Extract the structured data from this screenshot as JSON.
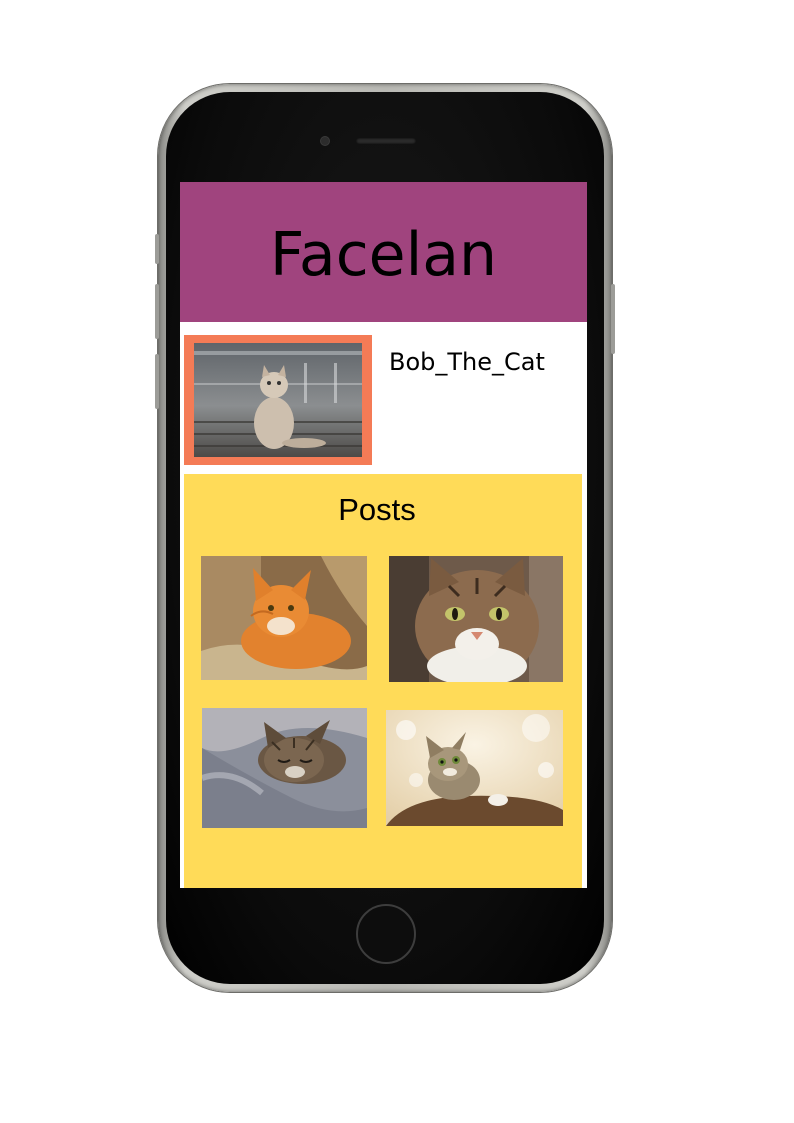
{
  "app": {
    "title": "Facelan"
  },
  "profile": {
    "username": "Bob_The_Cat",
    "avatar_icon": "cat-photo"
  },
  "posts": {
    "title": "Posts",
    "items": [
      {
        "icon": "orange-cat-photo"
      },
      {
        "icon": "tabby-cat-face-photo"
      },
      {
        "icon": "sleeping-cat-photo"
      },
      {
        "icon": "kitten-photo"
      }
    ]
  },
  "colors": {
    "header": "#a0447e",
    "posts_background": "#ffdb58",
    "avatar_border": "#f47b56",
    "screen_background": "#ffffff"
  }
}
